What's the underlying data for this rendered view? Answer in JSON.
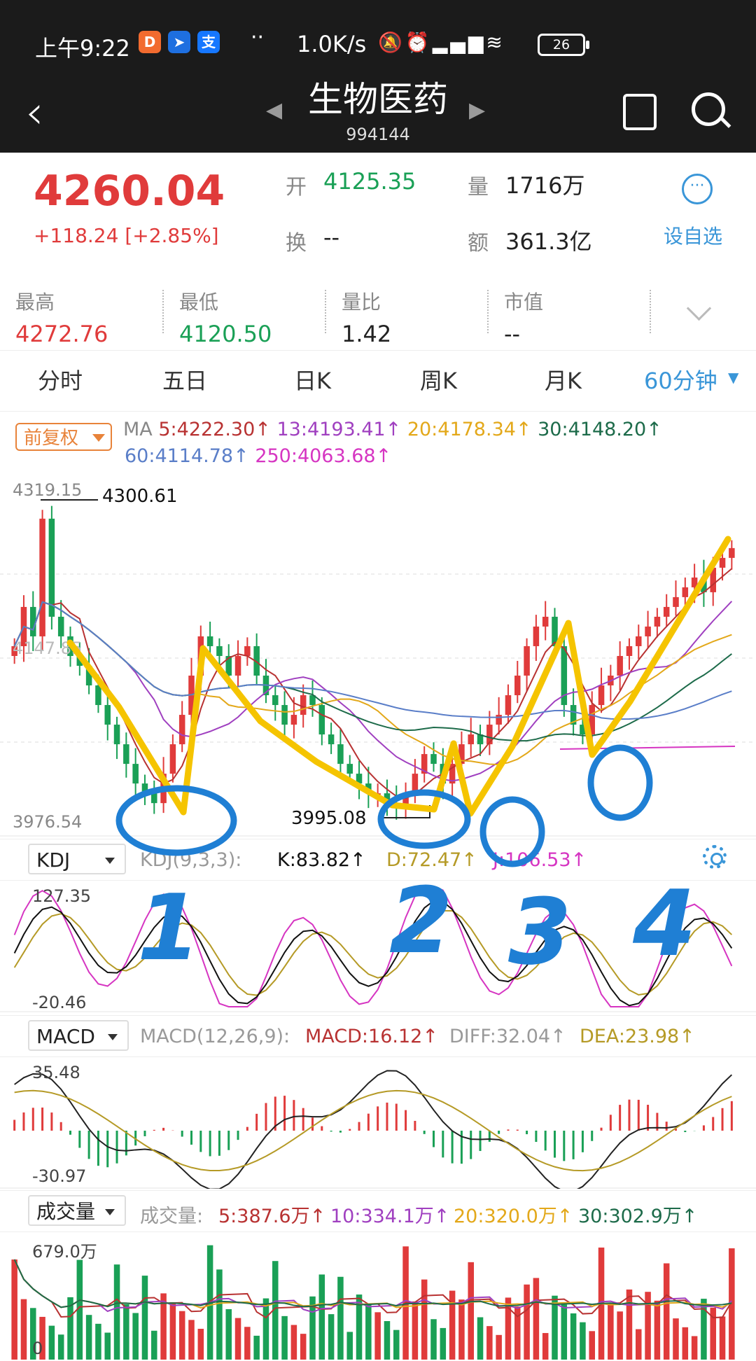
{
  "status_bar": {
    "time": "上午9:22",
    "app_icons": [
      "didi-icon",
      "dingtalk-icon",
      "alipay-icon"
    ],
    "alipay_glyph": "支",
    "more_dots": "··",
    "network_speed": "1.0K/s",
    "battery": "26"
  },
  "header": {
    "title": "生物医药",
    "code": "994144",
    "prev_arrow": "◀",
    "next_arrow": "▶",
    "back_glyph": "‹"
  },
  "quote": {
    "price": "4260.04",
    "change": "+118.24  [+2.85%]",
    "open_label": "开",
    "open_value": "4125.35",
    "volume_label": "量",
    "volume_value": "1716万",
    "turnover_label": "换",
    "turnover_value": "--",
    "amount_label": "额",
    "amount_value": "361.3亿",
    "add_fav": "设自选",
    "more_glyph": "···"
  },
  "stats": [
    {
      "label": "最高",
      "value": "4272.76"
    },
    {
      "label": "最低",
      "value": "4120.50"
    },
    {
      "label": "量比",
      "value": "1.42"
    },
    {
      "label": "市值",
      "value": "--"
    }
  ],
  "tabs": [
    "分时",
    "五日",
    "日K",
    "周K",
    "月K",
    "60分钟"
  ],
  "active_tab": "60分钟",
  "ma": {
    "adjust": "前复权",
    "label": "MA",
    "line1": [
      {
        "text": "5:4222.30↑",
        "color": "#b83232"
      },
      {
        "text": "13:4193.41↑",
        "color": "#a040c0"
      },
      {
        "text": "20:4178.34↑",
        "color": "#e3a81a"
      },
      {
        "text": "30:4148.20↑",
        "color": "#1d6b4a"
      }
    ],
    "line2": [
      {
        "text": "60:4114.78↑",
        "color": "#5a7ec8"
      },
      {
        "text": "250:4063.68↑",
        "color": "#d635c2"
      }
    ]
  },
  "kline_axis": {
    "high": "4319.15",
    "mid": "4147.85",
    "low": "3976.54",
    "max_marker": "4300.61",
    "min_marker": "3995.08"
  },
  "kdj": {
    "selector": "KDJ",
    "params": "KDJ(9,3,3):",
    "k": "K:83.82↑",
    "d": "D:72.47↑",
    "j": "J:106.53↑",
    "top": "127.35",
    "bottom": "-20.46"
  },
  "macd": {
    "selector": "MACD",
    "params": "MACD(12,26,9):",
    "macd": "MACD:16.12↑",
    "diff": "DIFF:32.04↑",
    "dea": "DEA:23.98↑",
    "top": "35.48",
    "bottom": "-30.97"
  },
  "volume": {
    "selector": "成交量",
    "label": "成交量:",
    "ma5": "5:387.6万↑",
    "ma10": "10:334.1万↑",
    "ma20": "20:320.0万↑",
    "ma30": "30:302.9万↑",
    "top": "679.0万",
    "bottom": "0"
  },
  "annotations": {
    "numbers": [
      "1",
      "2",
      "3",
      "4"
    ]
  },
  "colors": {
    "up": "#e03b3b",
    "down": "#1aa056",
    "accent": "#3a96d8",
    "annotation_yellow": "#f5c400",
    "annotation_blue": "#1f7fd4"
  },
  "chart_data": {
    "type": "candlestick",
    "title": "",
    "ylim": [
      3976.54,
      4319.15
    ],
    "approx_close": [
      4160,
      4200,
      4170,
      4290,
      4190,
      4170,
      4150,
      4140,
      4120,
      4100,
      4080,
      4060,
      4040,
      4020,
      4010,
      4000,
      4030,
      4060,
      4090,
      4130,
      4170,
      4160,
      4150,
      4130,
      4150,
      4160,
      4130,
      4110,
      4100,
      4080,
      4090,
      4110,
      4100,
      4070,
      4060,
      4040,
      4030,
      4020,
      4010,
      4010,
      4000,
      3995,
      4010,
      4030,
      4050,
      4040,
      4020,
      4040,
      4060,
      4070,
      4060,
      4080,
      4090,
      4110,
      4130,
      4160,
      4180,
      4190,
      4160,
      4100,
      4080,
      4070,
      4100,
      4120,
      4130,
      4150,
      4160,
      4170,
      4180,
      4190,
      4200,
      4210,
      4220,
      4230,
      4215,
      4240,
      4250,
      4260
    ],
    "indicators": {
      "kdj": {
        "k": 83.82,
        "d": 72.47,
        "j": 106.53
      },
      "macd": {
        "macd": 16.12,
        "diff": 32.04,
        "dea": 23.98
      },
      "volume_ma": {
        "ma5": 387.6,
        "ma10": 334.1,
        "ma20": 320.0,
        "ma30": 302.9
      }
    }
  }
}
